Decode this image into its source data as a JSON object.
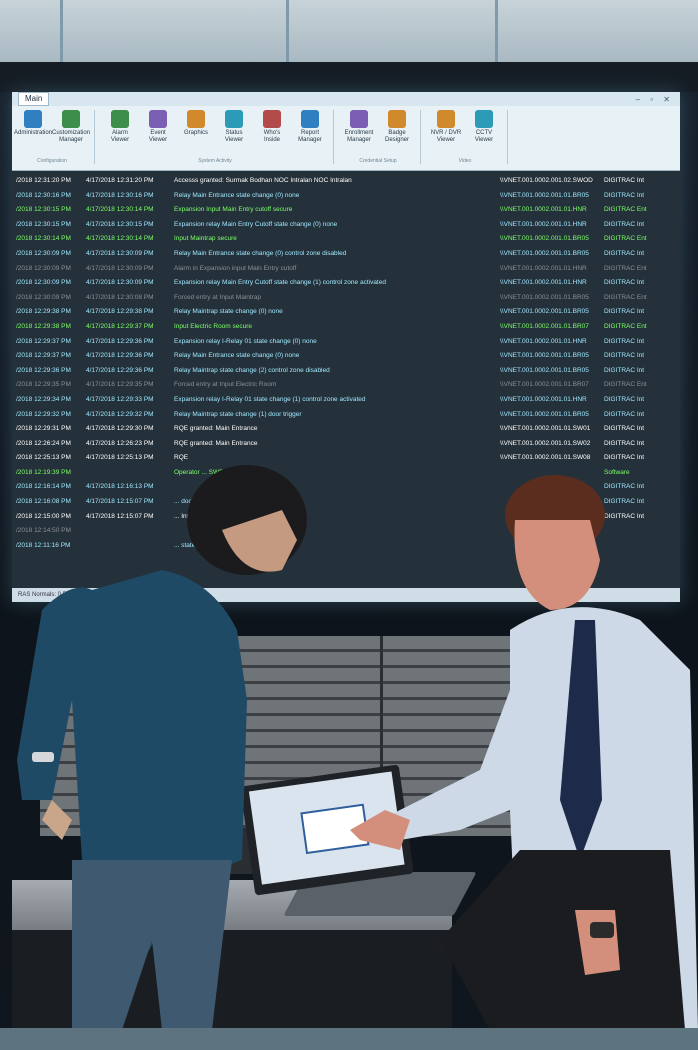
{
  "photo": {
    "description_tags": [
      "operations-center",
      "two-people",
      "laptop",
      "wall-display"
    ]
  },
  "wall_display": {
    "tab_label": "Main",
    "ribbon_groups": [
      {
        "label": "Configuration",
        "buttons": [
          "Administration",
          "Customization Manager"
        ]
      },
      {
        "label": "System Activity",
        "buttons": [
          "Alarm Viewer",
          "Event Viewer",
          "Graphics",
          "Status Viewer",
          "Who's Inside",
          "Report Manager"
        ]
      },
      {
        "label": "Credential Setup",
        "buttons": [
          "Enrollment Manager",
          "Badge Designer"
        ]
      },
      {
        "label": "Video",
        "buttons": [
          "NVR / DVR Viewer",
          "CCTV Viewer"
        ]
      }
    ],
    "log_rows": [
      {
        "c1": "/2018 12:31:20 PM",
        "c2": "4/17/2018 12:31:20 PM",
        "c3": "Accesss granted: Surmak Bodhan NOC Intralan NOC Intralan",
        "c4": "\\\\VNET.001.0002.001.02.SWOD",
        "c5": "DIGITRAC Int",
        "color": "#ffffff"
      },
      {
        "c1": "/2018 12:30:16 PM",
        "c2": "4/17/2018 12:30:16 PM",
        "c3": "Relay Main Entrance state change (0) none",
        "c4": "\\\\VNET.001.0002.001.01.BR05",
        "c5": "DIGITRAC Int",
        "color": "#9fe8ff"
      },
      {
        "c1": "/2018 12:30:15 PM",
        "c2": "4/17/2018 12:30:14 PM",
        "c3": "Expansion Input Main Entry cutoff secure",
        "c4": "\\\\VNET.001.0002.001.01.HNR",
        "c5": "DIGITRAC Ent",
        "color": "#7dff6a"
      },
      {
        "c1": "/2018 12:30:15 PM",
        "c2": "4/17/2018 12:30:15 PM",
        "c3": "Expansion relay Main Entry Cutoff state change (0) none",
        "c4": "\\\\VNET.001.0002.001.01.HNR",
        "c5": "DIGITRAC Int",
        "color": "#9fe8ff"
      },
      {
        "c1": "/2018 12:30:14 PM",
        "c2": "4/17/2018 12:30:14 PM",
        "c3": "Input Maintrap secure",
        "c4": "\\\\VNET.001.0002.001.01.BR05",
        "c5": "DIGITRAC Ent",
        "color": "#7dff6a"
      },
      {
        "c1": "/2018 12:30:09 PM",
        "c2": "4/17/2018 12:30:09 PM",
        "c3": "Relay Main Entrance state change (0) control zone disabled",
        "c4": "\\\\VNET.001.0002.001.01.BR05",
        "c5": "DIGITRAC Int",
        "color": "#9fe8ff"
      },
      {
        "c1": "/2018 12:30:09 PM",
        "c2": "4/17/2018 12:30:09 PM",
        "c3": "Alarm in Expansion input Main Entry cutoff",
        "c4": "\\\\VNET.001.0002.001.01.HNR",
        "c5": "DIGITRAC Ent",
        "color": "#8a8f95"
      },
      {
        "c1": "/2018 12:30:09 PM",
        "c2": "4/17/2018 12:30:09 PM",
        "c3": "Expansion relay Main Entry Cutoff state change (1) control zone activated",
        "c4": "\\\\VNET.001.0002.001.01.HNR",
        "c5": "DIGITRAC Int",
        "color": "#9fe8ff"
      },
      {
        "c1": "/2018 12:30:09 PM",
        "c2": "4/17/2018 12:30:08 PM",
        "c3": "Forced entry at Input Maintrap",
        "c4": "\\\\VNET.001.0002.001.01.BR05",
        "c5": "DIGITRAC Ent",
        "color": "#8a8f95"
      },
      {
        "c1": "/2018 12:29:38 PM",
        "c2": "4/17/2018 12:29:38 PM",
        "c3": "Relay Maintrap state change (0) none",
        "c4": "\\\\VNET.001.0002.001.01.BR05",
        "c5": "DIGITRAC Int",
        "color": "#9fe8ff"
      },
      {
        "c1": "/2018 12:29:38 PM",
        "c2": "4/17/2018 12:29:37 PM",
        "c3": "Input Electric Room secure",
        "c4": "\\\\VNET.001.0002.001.01.BR07",
        "c5": "DIGITRAC Ent",
        "color": "#7dff6a"
      },
      {
        "c1": "/2018 12:29:37 PM",
        "c2": "4/17/2018 12:29:36 PM",
        "c3": "Expansion relay I-Relay 01 state change (0) none",
        "c4": "\\\\VNET.001.0002.001.01.HNR",
        "c5": "DIGITRAC Int",
        "color": "#9fe8ff"
      },
      {
        "c1": "/2018 12:29:37 PM",
        "c2": "4/17/2018 12:29:36 PM",
        "c3": "Relay Main Entrance state change (0) none",
        "c4": "\\\\VNET.001.0002.001.01.BR05",
        "c5": "DIGITRAC Int",
        "color": "#9fe8ff"
      },
      {
        "c1": "/2018 12:29:36 PM",
        "c2": "4/17/2018 12:29:36 PM",
        "c3": "Relay Maintrap state change (2) control zone disabled",
        "c4": "\\\\VNET.001.0002.001.01.BR05",
        "c5": "DIGITRAC Int",
        "color": "#9fe8ff"
      },
      {
        "c1": "/2018 12:29:35 PM",
        "c2": "4/17/2018 12:29:35 PM",
        "c3": "Forced entry at Input Electric Room",
        "c4": "\\\\VNET.001.0002.001.01.BR07",
        "c5": "DIGITRAC Ent",
        "color": "#8a8f95"
      },
      {
        "c1": "/2018 12:29:34 PM",
        "c2": "4/17/2018 12:29:33 PM",
        "c3": "Expansion relay I-Relay 01 state change (1) control zone activated",
        "c4": "\\\\VNET.001.0002.001.01.HNR",
        "c5": "DIGITRAC Int",
        "color": "#9fe8ff"
      },
      {
        "c1": "/2018 12:29:32 PM",
        "c2": "4/17/2018 12:29:32 PM",
        "c3": "Relay Maintrap state change (1) door trigger",
        "c4": "\\\\VNET.001.0002.001.01.BR05",
        "c5": "DIGITRAC Int",
        "color": "#9fe8ff"
      },
      {
        "c1": "/2018 12:29:31 PM",
        "c2": "4/17/2018 12:29:30 PM",
        "c3": "RQE granted: Main Entrance",
        "c4": "\\\\VNET.001.0002.001.01.SW01",
        "c5": "DIGITRAC Int",
        "color": "#ffffff"
      },
      {
        "c1": "/2018 12:26:24 PM",
        "c2": "4/17/2018 12:26:23 PM",
        "c3": "RQE granted: Main Entrance",
        "c4": "\\\\VNET.001.0002.001.01.SW02",
        "c5": "DIGITRAC Int",
        "color": "#ffffff"
      },
      {
        "c1": "/2018 12:25:13 PM",
        "c2": "4/17/2018 12:25:13 PM",
        "c3": "RQE",
        "c4": "\\\\VNET.001.0002.001.01.SW08",
        "c5": "DIGITRAC Int",
        "color": "#ffffff"
      },
      {
        "c1": "/2018 12:19:39 PM",
        "c2": "",
        "c3": "Operator ... SWDVIEW TBROWN",
        "c4": "",
        "c5": "Software",
        "color": "#7dff6a"
      },
      {
        "c1": "/2018 12:16:14 PM",
        "c2": "4/17/2018 12:16:13 PM",
        "c3": "",
        "c4": "",
        "c5": "DIGITRAC Int",
        "color": "#9fe8ff"
      },
      {
        "c1": "/2018 12:16:08 PM",
        "c2": "4/17/2018 12:15:07 PM",
        "c3": "... door trigger",
        "c4": "",
        "c5": "DIGITRAC Int",
        "color": "#9fe8ff"
      },
      {
        "c1": "/2018 12:15:00 PM",
        "c2": "4/17/2018 12:15:07 PM",
        "c3": "... Intralan NOC Intralan",
        "c4": "",
        "c5": "DIGITRAC Int",
        "color": "#ffffff"
      },
      {
        "c1": "/2018 12:14:50 PM",
        "c2": "",
        "c3": "",
        "c4": "",
        "c5": "",
        "color": "#8a8f95"
      },
      {
        "c1": "/2018 12:11:16 PM",
        "c2": "",
        "c3": "... state change (0) none",
        "c4": "",
        "c5": "",
        "color": "#9fe8ff"
      }
    ],
    "status_text": "RAS Normals: 0  Report Level: Level1 ALLWS"
  },
  "colors": {
    "wall_bg": "#25313a",
    "ribbon_bg": "#e8f1f6",
    "woman_hoodie": "#1f4a66",
    "man_shirt": "#cdd9e6",
    "tie": "#1e2a4a"
  }
}
